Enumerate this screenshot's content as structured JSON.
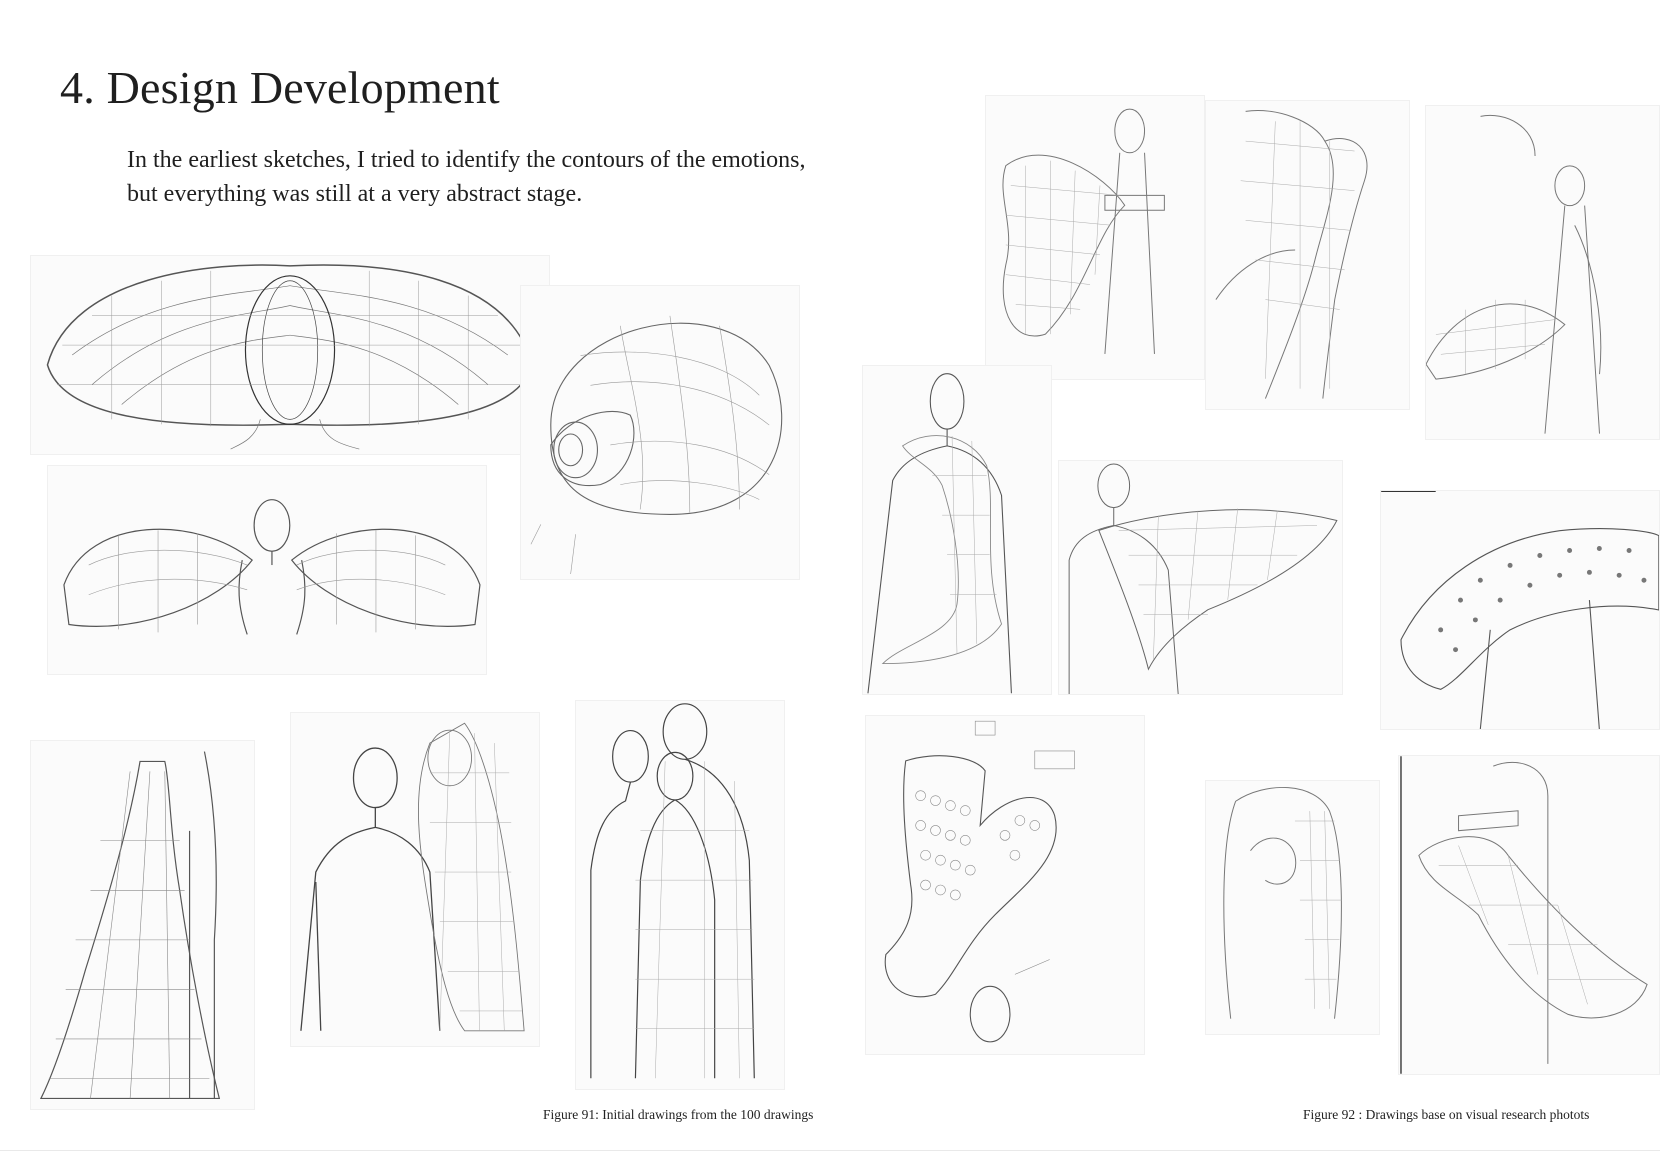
{
  "page": {
    "title": "4. Design Development",
    "intro_line1": "In the earliest sketches, I tried to identify the contours of the emotions,",
    "intro_line2": "but everything was still at a very abstract stage."
  },
  "figures": {
    "fig91_caption": "Figure 91: Initial drawings from the 100 drawings",
    "fig92_caption": "Figure 92 : Drawings base on visual research photots"
  }
}
